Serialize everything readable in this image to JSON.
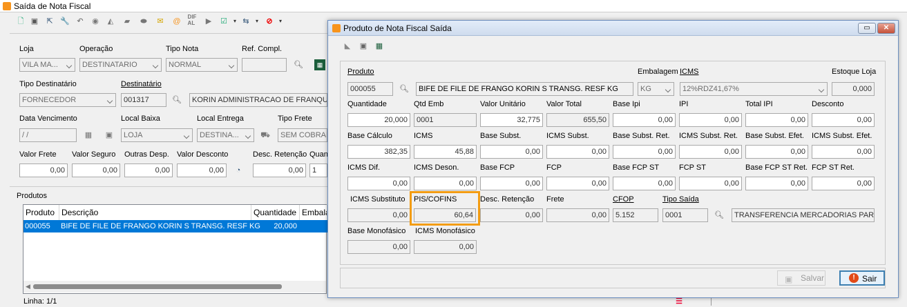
{
  "main": {
    "title": "Saída de Nota Fiscal",
    "fields": [
      {
        "label": "Loja",
        "value": "VILA MA..."
      },
      {
        "label": "Operação",
        "value": "DESTINATARIO"
      },
      {
        "label": "Tipo Nota",
        "value": "NORMAL"
      },
      {
        "label": "Ref. Compl.",
        "value": ""
      },
      {
        "label": "Tipo Destinatário",
        "value": "FORNECEDOR"
      },
      {
        "label": "Destinatário",
        "value": "001317",
        "desc": "KORIN ADMINISTRACAO DE FRANQUIA"
      },
      {
        "label": "Data Vencimento",
        "value": " / /"
      },
      {
        "label": "Local Baixa",
        "value": "LOJA"
      },
      {
        "label": "Local Entrega",
        "value": "DESTINA..."
      },
      {
        "label": "Tipo Frete",
        "value": "SEM COBRANÇ"
      },
      {
        "label": "Valor Frete",
        "value": "0,00"
      },
      {
        "label": "Valor Seguro",
        "value": "0,00"
      },
      {
        "label": "Outras Desp.",
        "value": "0,00"
      },
      {
        "label": "Valor Desconto",
        "value": "0,00"
      },
      {
        "label": "Desc. Retenção",
        "value": "0,00"
      },
      {
        "label": "Quan",
        "value": "1"
      }
    ],
    "products_label": "Produtos",
    "grid": {
      "headers": [
        "Produto",
        "Descrição",
        "Quantidade",
        "Embalag"
      ],
      "row": [
        "000055",
        "BIFE DE FILE DE FRANGO KORIN S  TRANSG. RESF KG",
        "20,000",
        ""
      ]
    },
    "status": "Linha: 1/1"
  },
  "dialog": {
    "title": "Produto de Nota Fiscal Saída",
    "produto": {
      "label": "Produto",
      "code": "000055",
      "desc": "BIFE DE FILE DE FRANGO KORIN S  TRANSG. RESF KG"
    },
    "embalagem": {
      "label": "Embalagem",
      "value": "KG"
    },
    "icms": {
      "label": "ICMS",
      "value": "12%RDZ41,67%"
    },
    "estoque": {
      "label": "Estoque Loja",
      "value": "0,000"
    },
    "rows": [
      [
        {
          "l": "Quantidade",
          "v": "20,000"
        },
        {
          "l": "Qtd Emb",
          "v": "0001"
        },
        {
          "l": "Valor Unitário",
          "v": "32,775"
        },
        {
          "l": "Valor Total",
          "v": "655,50"
        },
        {
          "l": "Base Ipi",
          "v": "0,00"
        },
        {
          "l": "IPI",
          "v": "0,00"
        },
        {
          "l": "Total IPI",
          "v": "0,00"
        },
        {
          "l": "Desconto",
          "v": "0,00"
        }
      ],
      [
        {
          "l": "Base Cálculo",
          "v": "382,35"
        },
        {
          "l": "ICMS",
          "v": "45,88"
        },
        {
          "l": "Base Subst.",
          "v": "0,00"
        },
        {
          "l": "ICMS Subst.",
          "v": "0,00"
        },
        {
          "l": "Base Subst. Ret.",
          "v": "0,00"
        },
        {
          "l": "ICMS Subst. Ret.",
          "v": "0,00"
        },
        {
          "l": "Base Subst. Efet.",
          "v": "0,00"
        },
        {
          "l": "ICMS Subst. Efet.",
          "v": "0,00"
        }
      ],
      [
        {
          "l": "ICMS Dif.",
          "v": "0,00"
        },
        {
          "l": "ICMS Deson.",
          "v": "0,00"
        },
        {
          "l": "Base FCP",
          "v": "0,00"
        },
        {
          "l": "FCP",
          "v": "0,00"
        },
        {
          "l": "Base FCP ST",
          "v": "0,00"
        },
        {
          "l": "FCP ST",
          "v": "0,00"
        },
        {
          "l": "Base FCP ST Ret.",
          "v": "0,00"
        },
        {
          "l": "FCP ST Ret.",
          "v": "0,00"
        }
      ]
    ],
    "row4": {
      "icms_substituto": {
        "l": "ICMS Substituto",
        "v": "0,00"
      },
      "pis_cofins": {
        "l": "PIS/COFINS",
        "v": "60,64"
      },
      "desc_retencao": {
        "l": "Desc. Retenção",
        "v": "0,00"
      },
      "frete": {
        "l": "Frete",
        "v": "0,00"
      },
      "cfop": {
        "l": "CFOP",
        "v": "5.152"
      },
      "tipo_saida": {
        "l": "Tipo Saída",
        "v": "0001",
        "desc": "TRANSFERENCIA MERCADORIAS PARA R"
      }
    },
    "row5": [
      {
        "l": "Base Monofásico",
        "v": "0,00"
      },
      {
        "l": "ICMS Monofásico",
        "v": "0,00"
      }
    ],
    "buttons": {
      "salvar": "Salvar",
      "sair": "Sair"
    },
    "highlight_color": "#f39c12"
  }
}
